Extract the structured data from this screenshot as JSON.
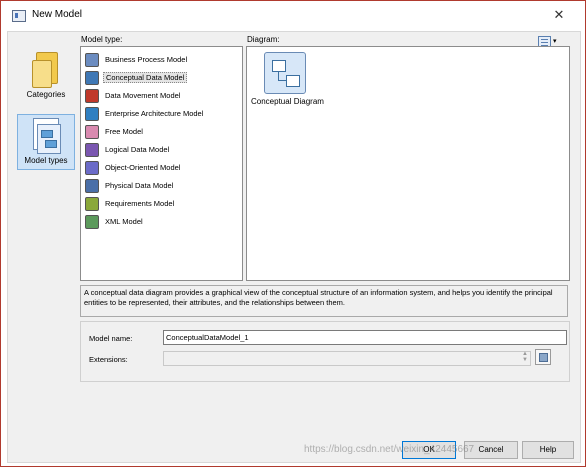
{
  "window": {
    "title": "New Model",
    "close_glyph": "✕"
  },
  "categories": [
    {
      "label": "Categories",
      "icon": "categories-icon",
      "selected": false
    },
    {
      "label": "Model types",
      "icon": "model-types-icon",
      "selected": true
    }
  ],
  "model_type": {
    "heading": "Model type:",
    "items": [
      {
        "label": "Business Process Model",
        "icon": "business-process-model-icon",
        "color": "#6b8cc0"
      },
      {
        "label": "Conceptual Data Model",
        "icon": "conceptual-data-model-icon",
        "color": "#3f78b5"
      },
      {
        "label": "Data Movement Model",
        "icon": "data-movement-model-icon",
        "color": "#c0392b"
      },
      {
        "label": "Enterprise Architecture Model",
        "icon": "enterprise-architecture-model-icon",
        "color": "#2f7fc1"
      },
      {
        "label": "Free Model",
        "icon": "free-model-icon",
        "color": "#d98ab0"
      },
      {
        "label": "Logical Data Model",
        "icon": "logical-data-model-icon",
        "color": "#7a56b0"
      },
      {
        "label": "Object-Oriented Model",
        "icon": "object-oriented-model-icon",
        "color": "#6b6bc8"
      },
      {
        "label": "Physical Data Model",
        "icon": "physical-data-model-icon",
        "color": "#4a6fa8"
      },
      {
        "label": "Requirements Model",
        "icon": "requirements-model-icon",
        "color": "#8aa83a"
      },
      {
        "label": "XML Model",
        "icon": "xml-model-icon",
        "color": "#5c9a5c"
      }
    ],
    "selected": "Conceptual Data Model"
  },
  "diagram": {
    "heading": "Diagram:",
    "label": "Conceptual Diagram",
    "view_menu_glyph": "▾"
  },
  "description": "A conceptual data diagram provides a graphical view of the conceptual structure of an information system, and helps you identify the principal entities to be represented, their attributes, and the relationships between them.",
  "form": {
    "model_name_label": "Model name:",
    "model_name_value": "ConceptualDataModel_1",
    "extensions_label": "Extensions:",
    "extensions_value": ""
  },
  "buttons": {
    "ok": "OK",
    "cancel": "Cancel",
    "help": "Help"
  },
  "watermark": "https://blog.csdn.net/weixin_42445667"
}
